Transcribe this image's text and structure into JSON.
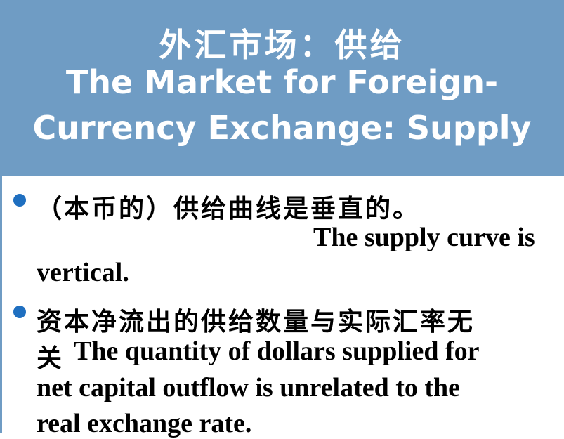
{
  "title": {
    "zh": "外汇市场：供给",
    "en_line1": "The Market for Foreign-",
    "en_line2": "Currency Exchange: Supply"
  },
  "bullets": [
    {
      "zh": "（本币的）供给曲线是垂直的。",
      "en_part1": "The supply curve is",
      "en_part2": "vertical."
    },
    {
      "zh_line1": "资本净流出的供给数量与实际汇率无",
      "zh_line2_prefix": "关",
      "en_line2": "The quantity of dollars supplied for",
      "en_line3": "net capital outflow is unrelated to the",
      "en_line4": "real exchange rate."
    }
  ],
  "colors": {
    "title_band": "#6f9cc4",
    "bullet": "#1f6fc0",
    "title_text": "#ffffff",
    "body_text": "#000000"
  }
}
